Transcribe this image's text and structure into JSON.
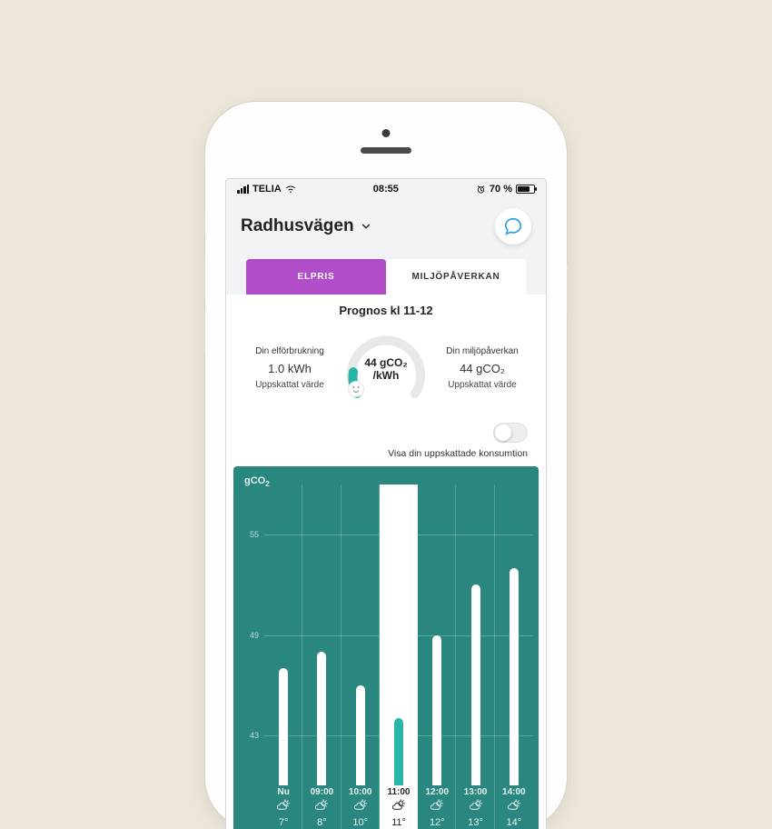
{
  "status": {
    "carrier": "TELIA",
    "time": "08:55",
    "battery_pct": "70 %"
  },
  "header": {
    "location": "Radhusvägen"
  },
  "tabs": {
    "elpris": "ELPRIS",
    "miljo": "MILJÖPÅVERKAN"
  },
  "forecast": {
    "title": "Prognos kl 11-12",
    "left": {
      "label": "Din elförbrukning",
      "value": "1.0 kWh",
      "note": "Uppskattat värde"
    },
    "right": {
      "label": "Din miljöpåverkan",
      "value": "44 gCO₂",
      "note": "Uppskattat värde"
    },
    "gauge": {
      "value": "44 gCO₂",
      "unit": "/kWh"
    }
  },
  "toggle": {
    "label": "Visa din uppskattade konsumtion"
  },
  "chart_data": {
    "type": "bar",
    "title": "gCO₂",
    "ylabel": "gCO₂",
    "ylim": [
      40,
      58
    ],
    "yticks": [
      43,
      49,
      55
    ],
    "categories": [
      "Nu",
      "09:00",
      "10:00",
      "11:00",
      "12:00",
      "13:00",
      "14:00"
    ],
    "values": [
      47,
      48,
      46,
      44,
      49,
      52,
      53
    ],
    "highlight_index": 3,
    "temps": [
      "7°",
      "8°",
      "10°",
      "11°",
      "12°",
      "13°",
      "14°"
    ]
  }
}
